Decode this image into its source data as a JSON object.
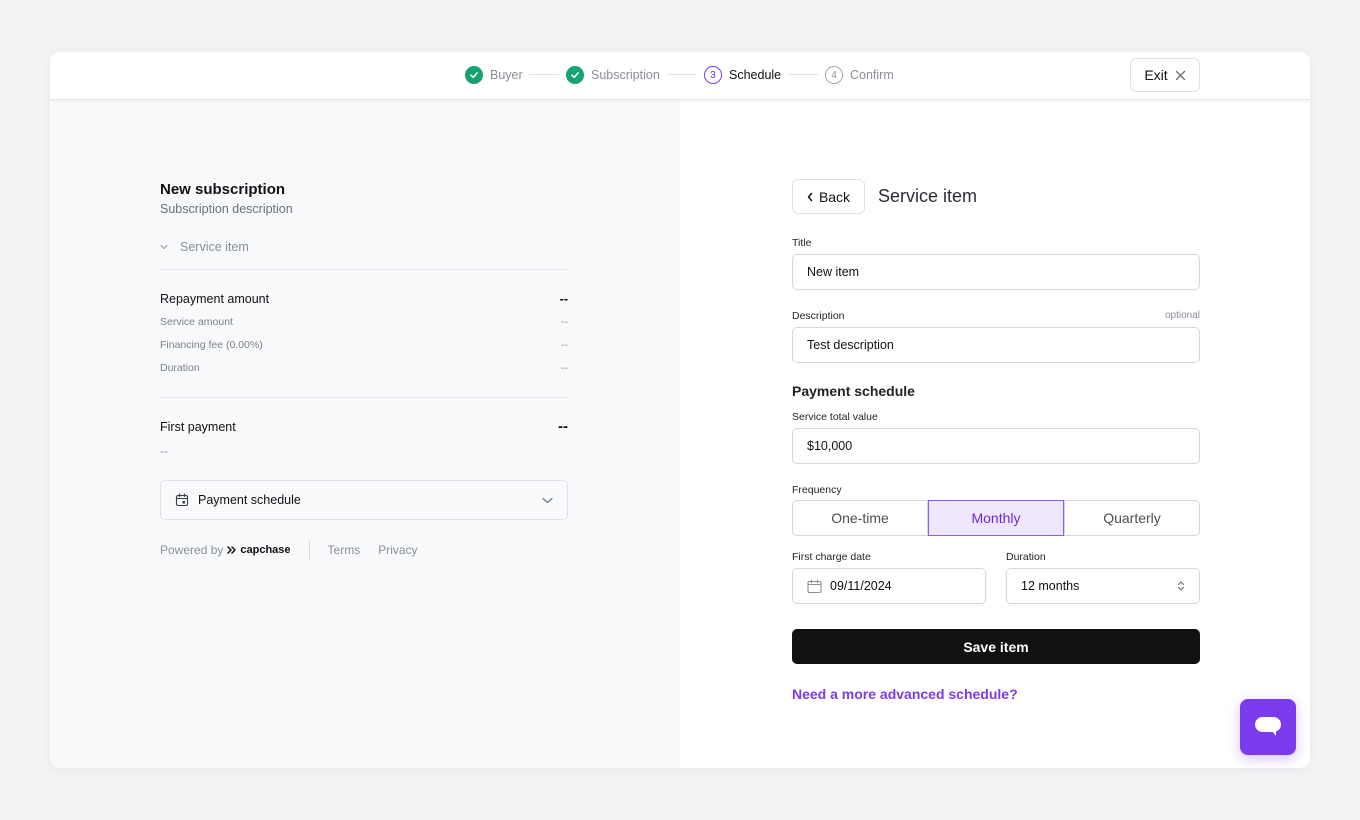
{
  "stepper": {
    "steps": [
      {
        "number": "1",
        "label": "Buyer",
        "state": "done"
      },
      {
        "number": "2",
        "label": "Subscription",
        "state": "done"
      },
      {
        "number": "3",
        "label": "Schedule",
        "state": "active"
      },
      {
        "number": "4",
        "label": "Confirm",
        "state": "todo"
      }
    ],
    "exit_label": "Exit"
  },
  "summary": {
    "title": "New subscription",
    "subtitle": "Subscription description",
    "service_item_label": "Service item",
    "repayment": {
      "label": "Repayment amount",
      "value": "--",
      "rows": [
        {
          "label": "Service amount",
          "value": "--"
        },
        {
          "label": "Financing fee (0.00%)",
          "value": "--"
        },
        {
          "label": "Duration",
          "value": "--"
        }
      ]
    },
    "first_payment": {
      "label": "First payment",
      "value": "--",
      "sub": "--"
    },
    "payment_schedule_label": "Payment schedule",
    "footer": {
      "powered_by": "Powered by",
      "brand": "capchase",
      "terms": "Terms",
      "privacy": "Privacy"
    }
  },
  "form": {
    "back_label": "Back",
    "title": "Service item",
    "title_field": {
      "label": "Title",
      "value": "New item"
    },
    "description_field": {
      "label": "Description",
      "optional": "optional",
      "value": "Test description"
    },
    "payment_schedule_title": "Payment schedule",
    "total_value_field": {
      "label": "Service total value",
      "value": "$10,000"
    },
    "frequency": {
      "label": "Frequency",
      "options": [
        "One-time",
        "Monthly",
        "Quarterly"
      ],
      "selected": "Monthly"
    },
    "first_charge": {
      "label": "First charge date",
      "value": "09/11/2024"
    },
    "duration": {
      "label": "Duration",
      "value": "12 months"
    },
    "save_label": "Save item",
    "advanced_link": "Need a more advanced schedule?"
  },
  "colors": {
    "accent": "#7c3aed",
    "success": "#16a36f",
    "primary_button": "#111114"
  }
}
